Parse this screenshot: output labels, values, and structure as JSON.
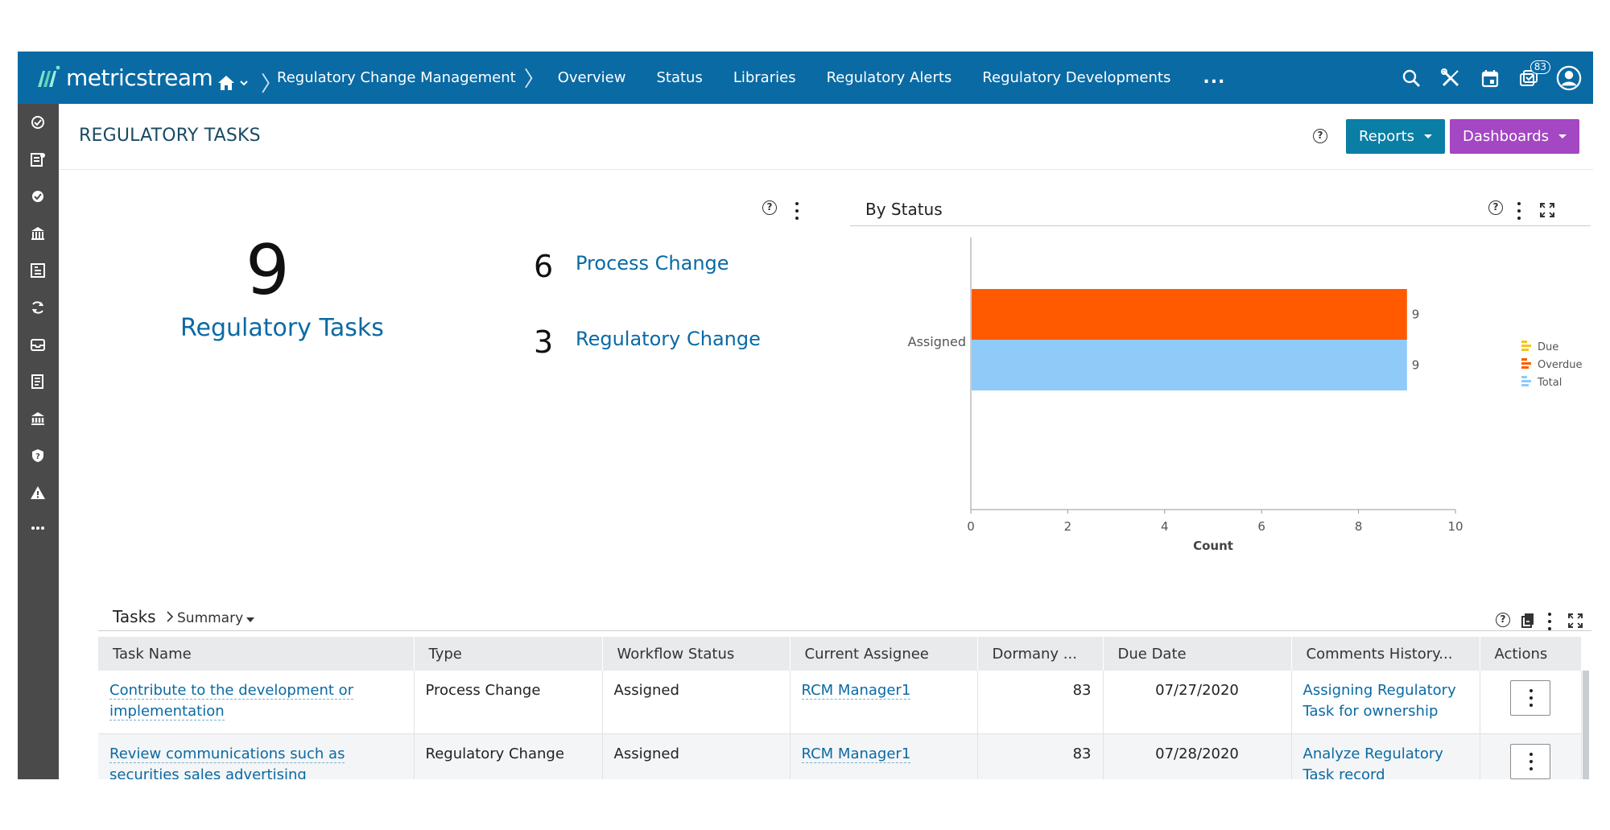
{
  "brand": {
    "name": "metricstream",
    "color": "#0a6aa4"
  },
  "nav": {
    "module": "Regulatory Change Management",
    "tabs": [
      "Overview",
      "Status",
      "Libraries",
      "Regulatory Alerts",
      "Regulatory Developments"
    ],
    "more": "...",
    "notifications_count": "83"
  },
  "page": {
    "title": "REGULATORY TASKS",
    "reports_label": "Reports",
    "dashboards_label": "Dashboards",
    "help": "?"
  },
  "summary": {
    "total": "9",
    "total_label": "Regulatory Tasks",
    "categories": [
      {
        "count": "6",
        "label": "Process Change"
      },
      {
        "count": "3",
        "label": "Regulatory Change"
      }
    ]
  },
  "chart_data": {
    "type": "bar",
    "orientation": "horizontal",
    "title": "By Status",
    "categories": [
      "Assigned"
    ],
    "series": [
      {
        "name": "Due",
        "values": [
          0
        ],
        "color": "#f5c518"
      },
      {
        "name": "Overdue",
        "values": [
          9
        ],
        "color": "#ff5a00"
      },
      {
        "name": "Total",
        "values": [
          9
        ],
        "color": "#8fcaf9"
      }
    ],
    "xlabel": "Count",
    "xlim": [
      0,
      10
    ],
    "xticks": [
      "0",
      "2",
      "4",
      "6",
      "8",
      "10"
    ],
    "legend": "right",
    "grid": false
  },
  "tasks": {
    "title": "Tasks",
    "view": "Summary",
    "columns": [
      "Task Name",
      "Type",
      "Workflow Status",
      "Current Assignee",
      "Dormany ...",
      "Due Date",
      "Comments History...",
      "Actions"
    ],
    "rows": [
      {
        "name": "Contribute to the development or implementation",
        "type": "Process Change",
        "status": "Assigned",
        "assignee": "RCM Manager1",
        "dormancy": "83",
        "due": "07/27/2020",
        "comments": "Assigning Regulatory Task for ownership"
      },
      {
        "name": "Review communications such as securities sales advertising",
        "type": "Regulatory Change",
        "status": "Assigned",
        "assignee": "RCM Manager1",
        "dormancy": "83",
        "due": "07/28/2020",
        "comments": "Analyze Regulatory Task record"
      }
    ]
  },
  "rail_icons": [
    "assessment-icon",
    "policy-icon",
    "settings-check-icon",
    "regulator-icon",
    "library-icon",
    "refresh-cycle-icon",
    "inbox-icon",
    "document-list-icon",
    "bank-icon",
    "risk-icon",
    "warning-icon",
    "more-icon"
  ]
}
